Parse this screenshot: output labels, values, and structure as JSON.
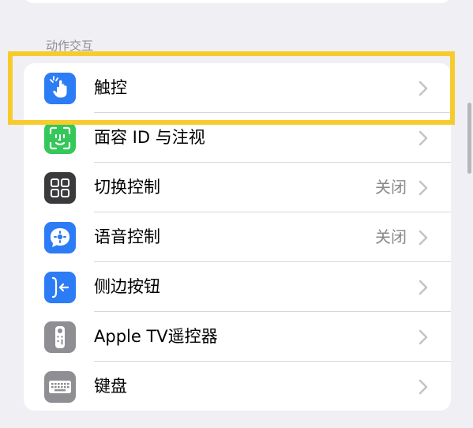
{
  "section": {
    "header": "动作交互"
  },
  "rows": [
    {
      "label": "触控",
      "value": "",
      "icon": "touch-hand-icon",
      "icon_color": "#2c7cf6"
    },
    {
      "label": "面容 ID 与注视",
      "value": "",
      "icon": "face-id-icon",
      "icon_color": "#34c759"
    },
    {
      "label": "切换控制",
      "value": "关闭",
      "icon": "switch-control-icon",
      "icon_color": "#3a3a3c"
    },
    {
      "label": "语音控制",
      "value": "关闭",
      "icon": "voice-control-icon",
      "icon_color": "#2c7cf6"
    },
    {
      "label": "侧边按钮",
      "value": "",
      "icon": "side-button-icon",
      "icon_color": "#2c7cf6"
    },
    {
      "label": "Apple TV遥控器",
      "value": "",
      "icon": "apple-tv-remote-icon",
      "icon_color": "#8e8e93"
    },
    {
      "label": "键盘",
      "value": "",
      "icon": "keyboard-icon",
      "icon_color": "#8e8e93"
    }
  ],
  "colors": {
    "highlight": "#f7cb2e",
    "background": "#efeff4",
    "chevron": "#c4c4c7"
  }
}
